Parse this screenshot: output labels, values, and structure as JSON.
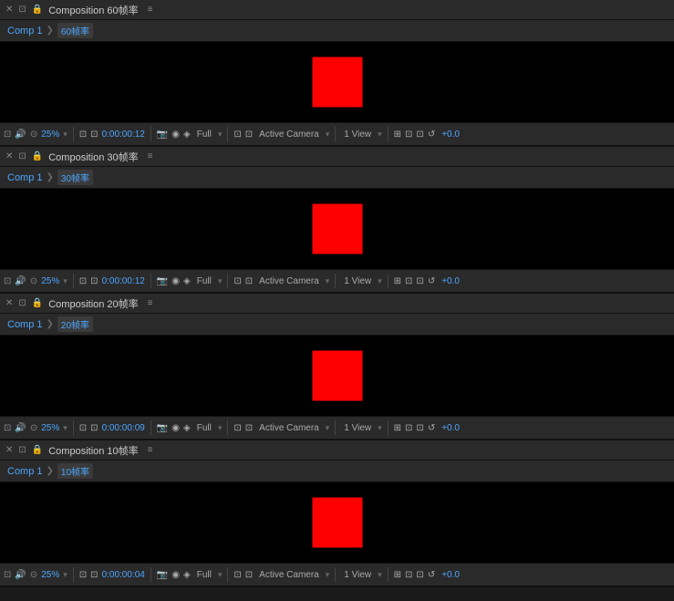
{
  "panels": [
    {
      "id": "panel-60",
      "title": "Composition 60帧率",
      "fps_label": "60帧率",
      "crumb": "Comp 1",
      "preview_height": 88,
      "timecode": "0:00:00:12",
      "zoom": "25%",
      "quality": "Full",
      "camera": "Active Camera",
      "view": "1 View",
      "plus_val": "+0.0"
    },
    {
      "id": "panel-30",
      "title": "Composition 30帧率",
      "fps_label": "30帧率",
      "crumb": "Comp 1",
      "preview_height": 88,
      "timecode": "0:00:00:12",
      "zoom": "25%",
      "quality": "Full",
      "camera": "Active Camera",
      "view": "1 View",
      "plus_val": "+0.0"
    },
    {
      "id": "panel-20",
      "title": "Composition 20帧率",
      "fps_label": "20帧率",
      "crumb": "Comp 1",
      "preview_height": 88,
      "timecode": "0:00:00:09",
      "zoom": "25%",
      "quality": "Full",
      "camera": "Active Camera",
      "view": "1 View",
      "plus_val": "+0.0"
    },
    {
      "id": "panel-10",
      "title": "Composition 10帧率",
      "fps_label": "10帧率",
      "crumb": "Comp 1",
      "preview_height": 88,
      "timecode": "0:00:00:04",
      "zoom": "25%",
      "quality": "Full",
      "camera": "Active Camera",
      "view": "1 View",
      "plus_val": "+0.0"
    }
  ],
  "icons": {
    "close": "✕",
    "lock": "🔒",
    "hamburger": "≡",
    "arrow": "❯",
    "camera_icon": "📷",
    "color_wheel": "◉",
    "monitor": "⊡",
    "snapshot": "📸",
    "grid": "⊞",
    "reset": "↺",
    "expand": "⤢"
  }
}
